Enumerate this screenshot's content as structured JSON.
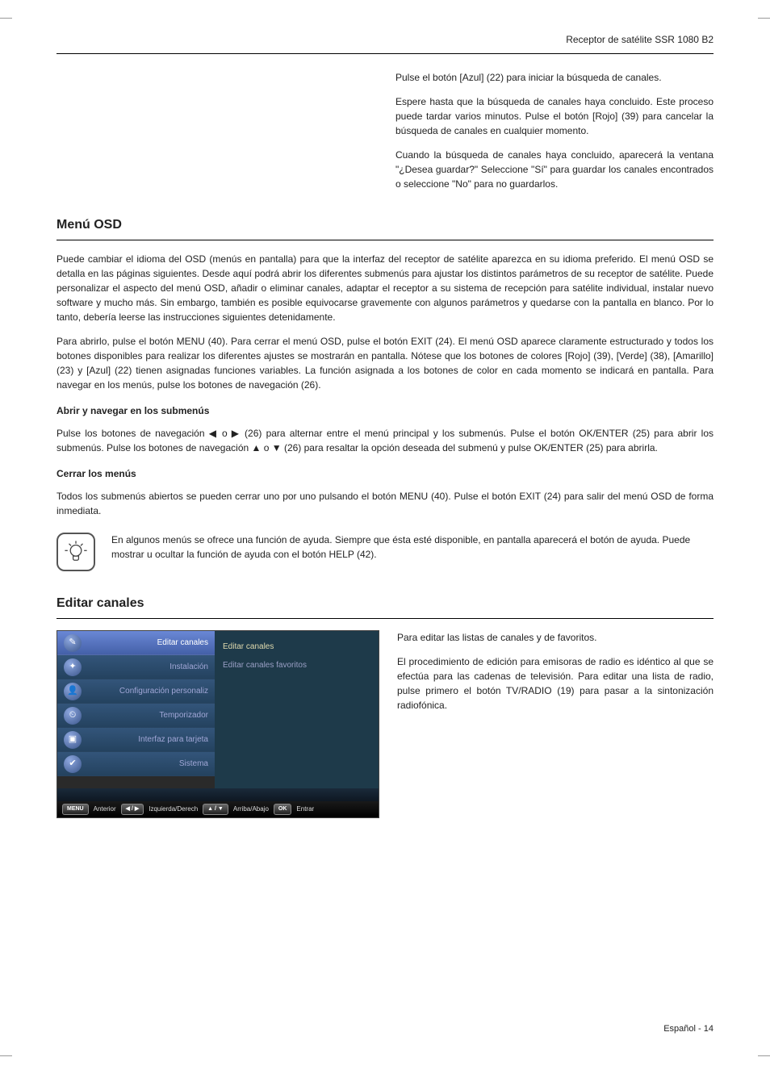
{
  "header": {
    "product": "Receptor de satélite SSR 1080 B2"
  },
  "intro": {
    "p1": "Pulse el botón [Azul] (22) para iniciar la búsqueda de canales.",
    "p2": "Espere hasta que la búsqueda de canales haya concluido. Este proceso puede tardar varios minutos. Pulse el botón [Rojo] (39) para cancelar la búsqueda de canales en cualquier momento.",
    "p3": "Cuando la búsqueda de canales haya concluido, aparecerá la ventana \"¿Desea guardar?\" Seleccione \"Sí\" para guardar los canales encontrados o seleccione \"No\" para no guardarlos."
  },
  "menu_osd": {
    "title": "Menú OSD",
    "p1": "Puede cambiar el idioma del OSD (menús en pantalla) para que la interfaz del receptor de satélite aparezca en su idioma preferido. El menú OSD se detalla en las páginas siguientes. Desde aquí podrá abrir los diferentes submenús para ajustar los distintos parámetros de su receptor de satélite. Puede personalizar el aspecto del menú OSD, añadir o eliminar canales, adaptar el receptor a su sistema de recepción para satélite individual, instalar nuevo software y mucho más. Sin embargo, también es posible equivocarse gravemente con algunos parámetros y quedarse con la pantalla en blanco. Por lo tanto, debería leerse las instrucciones siguientes detenidamente.",
    "p2": "Para abrirlo, pulse el botón MENU (40). Para cerrar el menú OSD, pulse el botón EXIT (24). El menú OSD aparece claramente estructurado y todos los botones disponibles para realizar los diferentes ajustes se mostrarán en pantalla. Nótese que los botones de colores [Rojo] (39), [Verde] (38), [Amarillo] (23) y [Azul] (22) tienen asignadas funciones variables. La función asignada a los botones de color en cada momento se indicará en pantalla. Para navegar en los menús, pulse los botones de navegación (26).",
    "sub_open_title": "Abrir y navegar en los submenús",
    "sub_open_p_pre": "Pulse los botones de navegación ",
    "sub_open_p_mid1": " o ",
    "sub_open_p_mid2": " (26) para alternar entre el menú principal y los submenús. Pulse el botón OK/ENTER (25) para abrir los submenús. Pulse los botones de navegación ",
    "sub_open_p_mid3": " o ",
    "sub_open_p_post": " (26) para resaltar la opción deseada del submenú y pulse OK/ENTER (25) para abrirla.",
    "sub_close_title": "Cerrar los menús",
    "sub_close_p": "Todos los submenús abiertos se pueden cerrar uno por uno pulsando el botón MENU (40). Pulse el botón EXIT (24) para salir del menú OSD de forma inmediata.",
    "note": "En algunos menús se ofrece una función de ayuda. Siempre que ésta esté disponible, en pantalla aparecerá el botón de ayuda. Puede mostrar u ocultar la función de ayuda con el botón HELP (42)."
  },
  "editar": {
    "title": "Editar canales",
    "p1": "Para editar las listas de canales y de favoritos.",
    "p2": "El procedimiento de edición para emisoras de radio es idéntico al que se efectúa para las cadenas de televisión. Para editar una lista de radio, pulse primero el botón TV/RADIO (19) para pasar a la sintonización radiofónica."
  },
  "osd_shot": {
    "left": [
      {
        "label": "Editar canales",
        "glyph": "✎",
        "selected": true
      },
      {
        "label": "Instalación",
        "glyph": "✦",
        "selected": false
      },
      {
        "label": "Configuración personaliz",
        "glyph": "👤",
        "selected": false
      },
      {
        "label": "Temporizador",
        "glyph": "⏲",
        "selected": false
      },
      {
        "label": "Interfaz para tarjeta",
        "glyph": "▣",
        "selected": false
      },
      {
        "label": "Sistema",
        "glyph": "✔",
        "selected": false
      }
    ],
    "right": [
      "Editar canales",
      "Editar canales favoritos"
    ],
    "footer": {
      "k1": "MENU",
      "l1": "Anterior",
      "k2": "◀ / ▶",
      "l2": "Izquierda/Derech",
      "k3": "▲ / ▼",
      "l3": "Arriba/Abajo",
      "k4": "OK",
      "l4": "Entrar"
    }
  },
  "arrows": {
    "left": "◀",
    "right": "▶",
    "up": "▲",
    "down": "▼"
  },
  "footer": {
    "lang": "Español",
    "sep": "-",
    "page": "14"
  }
}
